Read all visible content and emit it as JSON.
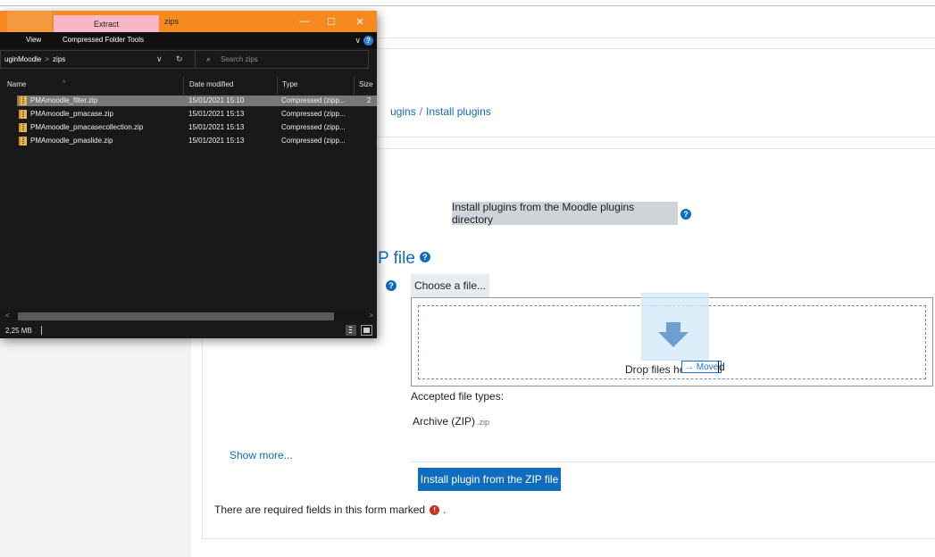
{
  "moodle": {
    "breadcrumb": {
      "parent": "ugins",
      "separator": "/",
      "current": "Install plugins"
    },
    "install_directory_button": "Install plugins from the Moodle plugins directory",
    "help_glyph": "?",
    "zip_section_heading": "P file",
    "choose_file_button": "Choose a file...",
    "drop_text": "Drop files here",
    "drop_text_tail": "d",
    "move_tooltip": "→ Move",
    "accepted_types_label": "Accepted file types:",
    "archive_label": "Archive (ZIP)",
    "archive_ext": ".zip",
    "show_more_link": "Show more...",
    "install_zip_button": "Install plugin from the ZIP file",
    "required_note_prefix": "There are required fields in this form marked",
    "required_glyph": "!",
    "required_note_suffix": "."
  },
  "explorer": {
    "ribbon_tab_extract": "Extract",
    "window_title": "zips",
    "controls": {
      "minimize": "—",
      "maximize": "☐",
      "close": "✕"
    },
    "ribbon": {
      "view": "View",
      "compressed_tools": "Compressed Folder Tools",
      "chevron": "∨",
      "help": "?"
    },
    "address": {
      "parent": "uginMoodle",
      "sep": ">",
      "current": "zips",
      "chevron": "∨",
      "refresh": "↻"
    },
    "search": {
      "icon": "⌕",
      "placeholder": "Search zips"
    },
    "columns": {
      "name": "Name",
      "date": "Date modified",
      "type": "Type",
      "size": "Size",
      "sort_caret": "^"
    },
    "files": [
      {
        "name": "PMAmoodle_filter.zip",
        "date": "15/01/2021 15:10",
        "type": "Compressed (zipp...",
        "size": "2",
        "selected": true
      },
      {
        "name": "PMAmoodle_pmacase.zip",
        "date": "15/01/2021 15:13",
        "type": "Compressed (zipp...",
        "size": "",
        "selected": false
      },
      {
        "name": "PMAmoodle_pmacasecollection.zip",
        "date": "15/01/2021 15:13",
        "type": "Compressed (zipp...",
        "size": "",
        "selected": false
      },
      {
        "name": "PMAmoodle_pmaslide.zip",
        "date": "15/01/2021 15:13",
        "type": "Compressed (zipp...",
        "size": "",
        "selected": false
      }
    ],
    "scroll": {
      "left": "<",
      "right": ">"
    },
    "status": "2,25 MB"
  },
  "colors": {
    "moodle_primary": "#0f6cbf",
    "explorer_titlebar": "#f58a1f",
    "extract_tab": "#f7b7c6",
    "required_red": "#ca3120"
  }
}
